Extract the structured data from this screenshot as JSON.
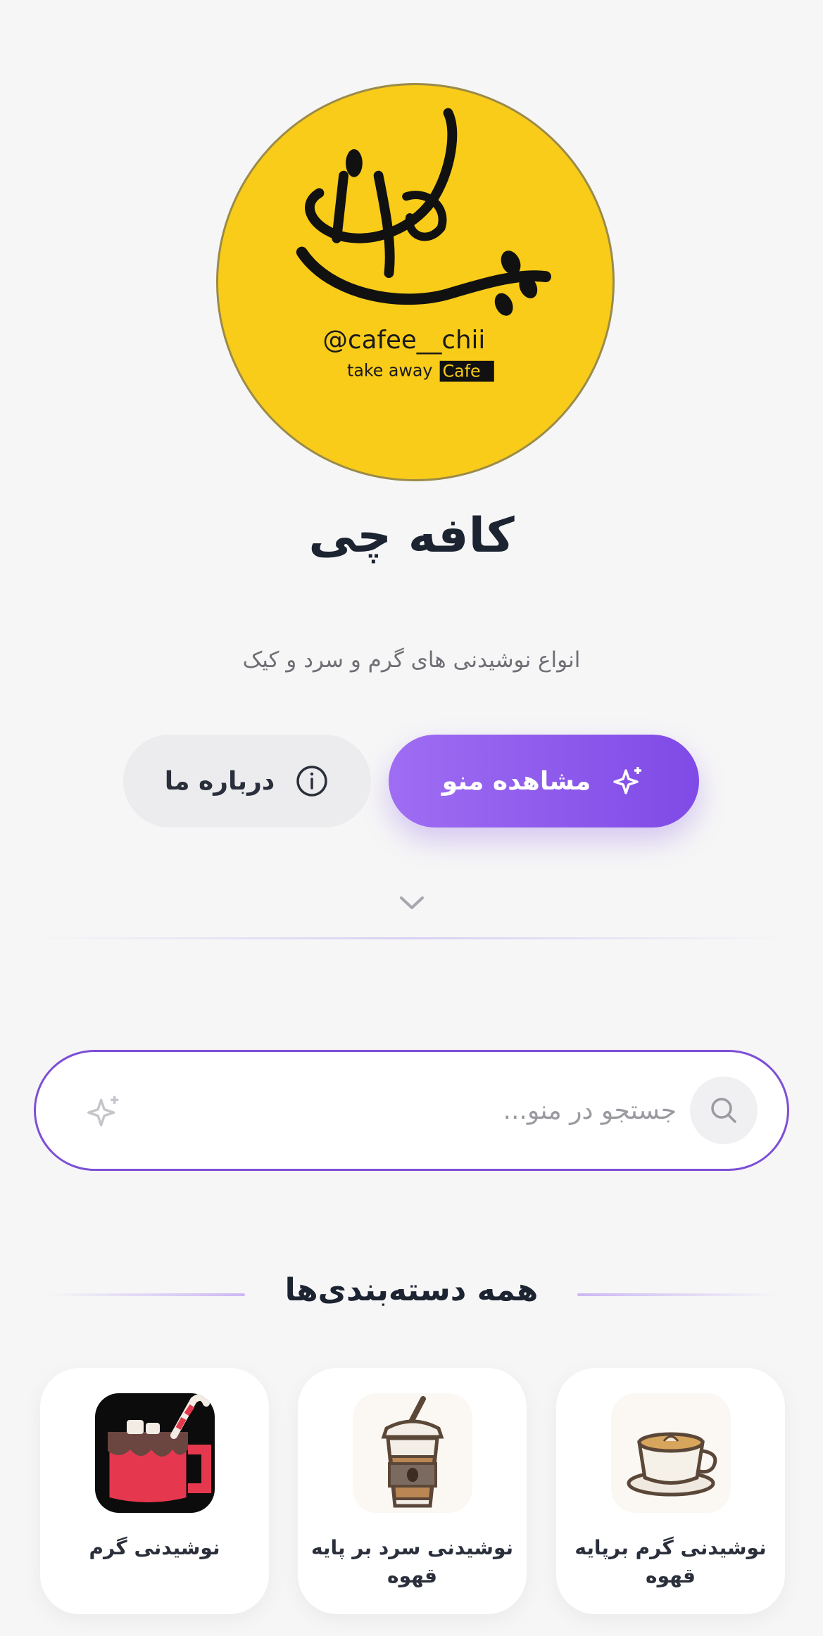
{
  "brand": {
    "name": "کافه چی",
    "tagline": "انواع نوشیدنی های گرم و سرد و کیک",
    "logo_text": {
      "handle": "@cafee__chii",
      "line": "take away",
      "badge": "Cafe"
    }
  },
  "actions": {
    "menu_label": "مشاهده منو",
    "about_label": "درباره ما"
  },
  "search": {
    "placeholder": "جستجو در منو..."
  },
  "categories": {
    "heading": "همه دسته‌بندی‌ها",
    "items": [
      {
        "label": "نوشیدنی گرم برپایه قهوه",
        "icon": "latte-cup-icon"
      },
      {
        "label": "نوشیدنی سرد بر پایه قهوه",
        "icon": "iced-coffee-icon"
      },
      {
        "label": "نوشیدنی گرم",
        "icon": "hot-chocolate-mug-icon"
      }
    ]
  },
  "colors": {
    "accent": "#7f4ae6",
    "logo_bg": "#f9cc19",
    "text": "#1c2331"
  }
}
